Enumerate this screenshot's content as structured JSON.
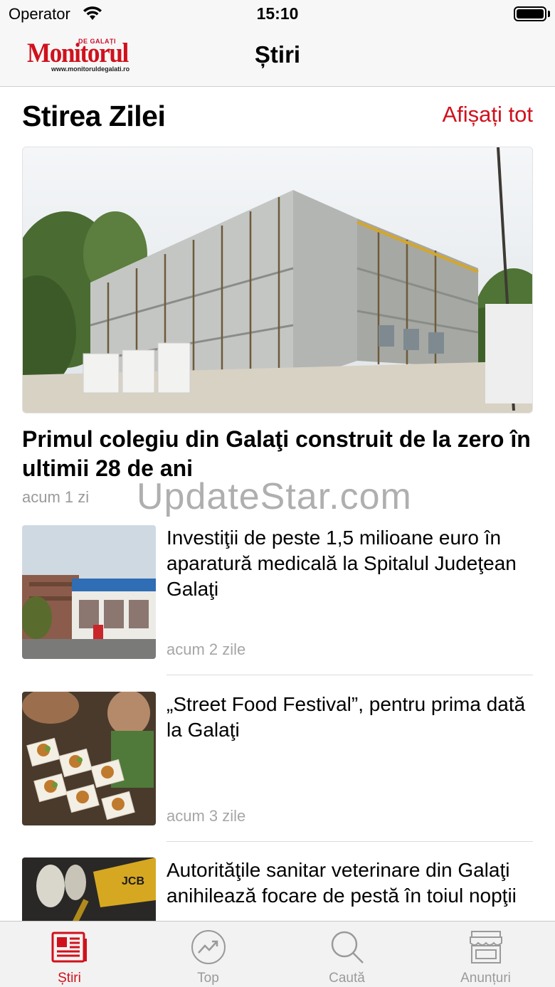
{
  "status_bar": {
    "carrier": "Operator",
    "time": "15:10"
  },
  "nav": {
    "title": "Știri",
    "logo": {
      "top_text": "DE GALAȚI",
      "main_text": "Monitorul",
      "url_text": "www.monitoruldegalati.ro"
    }
  },
  "section": {
    "title": "Stirea Zilei",
    "see_all": "Afișați tot"
  },
  "featured": {
    "title": "Primul colegiu din Galaţi construit de la zero în ultimii 28 de ani",
    "time": "acum 1 zi"
  },
  "watermark": "UpdateStar.com",
  "articles": [
    {
      "title": "Investiţii de peste 1,5 milioane euro în aparatură medicală la Spitalul Judeţean Galaţi",
      "time": "acum 2 zile"
    },
    {
      "title": "„Street Food Festival”, pentru prima dată la Galaţi",
      "time": "acum 3 zile"
    },
    {
      "title": "Autorităţile sanitar veterinare din Galaţi anihilează focare de pestă în toiul nopţii",
      "time": ""
    }
  ],
  "tabs": [
    {
      "label": "Știri",
      "icon": "newspaper-icon",
      "active": true
    },
    {
      "label": "Top",
      "icon": "trending-icon",
      "active": false
    },
    {
      "label": "Caută",
      "icon": "search-icon",
      "active": false
    },
    {
      "label": "Anunțuri",
      "icon": "store-icon",
      "active": false
    }
  ],
  "colors": {
    "accent": "#d0111c",
    "muted": "#9a9a9a"
  }
}
